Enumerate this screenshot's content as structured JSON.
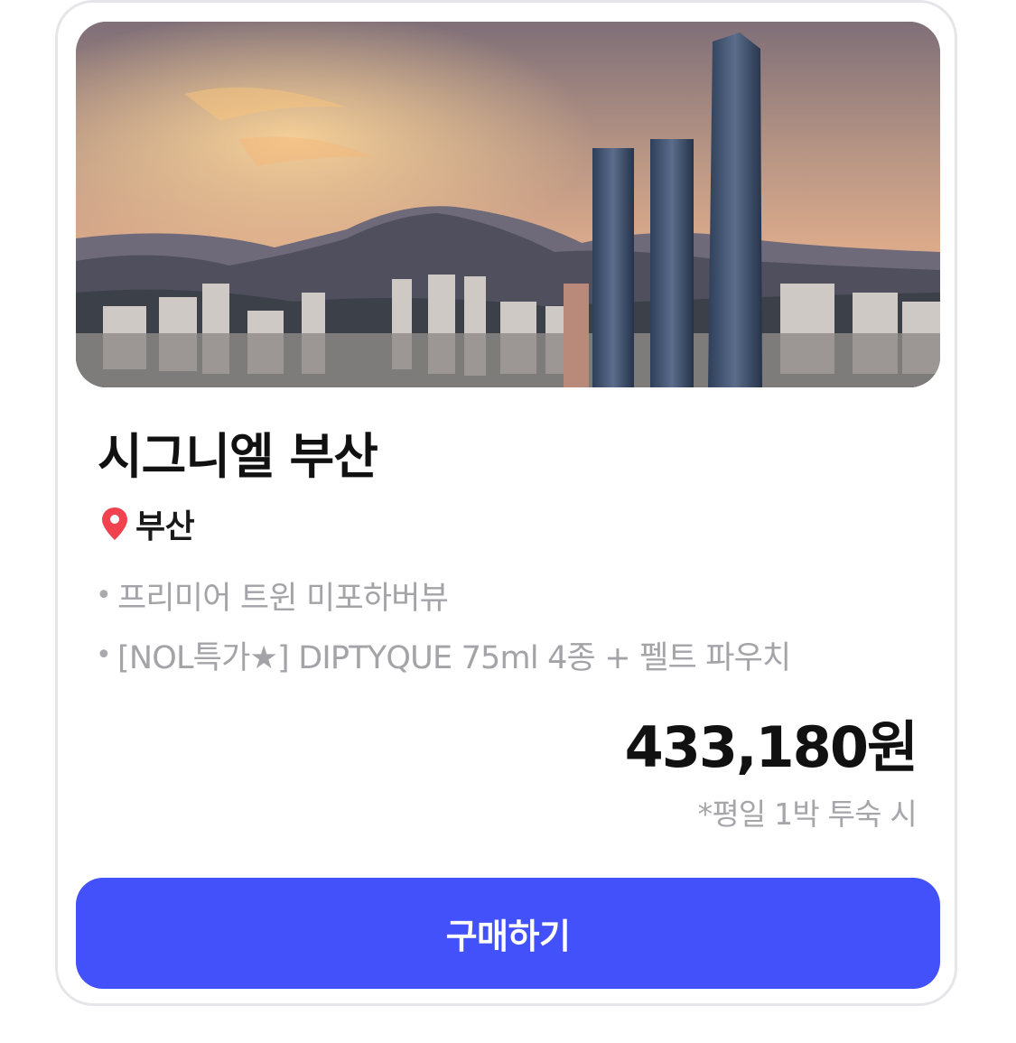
{
  "hotel": {
    "name": "시그니엘 부산",
    "location": "부산",
    "features": [
      "프리미어 트윈 미포하버뷰",
      "[NOL특가★] DIPTYQUE 75ml 4종 + 펠트 파우치"
    ],
    "bullet": "•",
    "price": "433,180원",
    "price_note": "*평일 1박 투숙 시"
  },
  "actions": {
    "buy_label": "구매하기"
  },
  "colors": {
    "accent": "#4351fb",
    "pin": "#f0434f",
    "muted_text": "#a3a3a8",
    "card_border": "#e6e6ea"
  },
  "icons": {
    "location": "map-pin-icon"
  }
}
